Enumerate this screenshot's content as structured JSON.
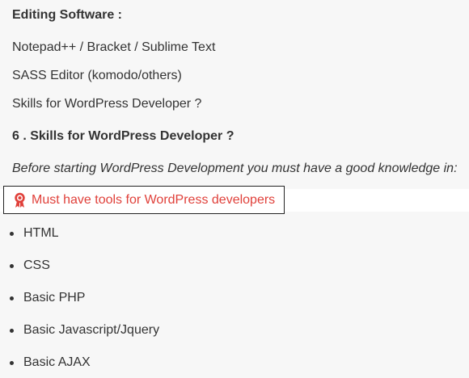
{
  "sections": {
    "editing_heading": "Editing Software :",
    "editors": [
      "Notepad++ / Bracket / Sublime Text",
      "SASS Editor (komodo/others)",
      "Skills for WordPress Developer ?"
    ],
    "skills_heading": "6 . Skills for WordPress Developer ?",
    "intro": "Before starting WordPress Development you must have a good knowledge in:"
  },
  "callout": {
    "label": "Must have tools for WordPress developers",
    "icon": "award-ribbon-icon",
    "color": "#e0403a"
  },
  "skills_list": [
    "HTML",
    "CSS",
    "Basic PHP",
    "Basic Javascript/Jquery",
    "Basic AJAX"
  ]
}
